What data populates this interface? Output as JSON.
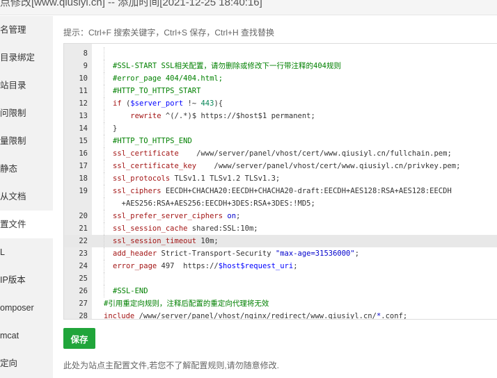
{
  "title": "点修改[www.qiusiyl.cn] -- 添加时间[2021-12-25 18:40:16]",
  "sidebar": {
    "items": [
      {
        "label": "名管理",
        "active": false
      },
      {
        "label": "目录绑定",
        "active": false
      },
      {
        "label": "站目录",
        "active": false
      },
      {
        "label": "问限制",
        "active": false
      },
      {
        "label": "量限制",
        "active": false
      },
      {
        "label": "静态",
        "active": false
      },
      {
        "label": "从文档",
        "active": false
      },
      {
        "label": "置文件",
        "active": true
      },
      {
        "label": "L",
        "active": false
      },
      {
        "label": "IP版本",
        "active": false
      },
      {
        "label": "omposer",
        "active": false
      },
      {
        "label": "mcat",
        "active": false
      },
      {
        "label": "定向",
        "active": false
      }
    ]
  },
  "hint": "提示：Ctrl+F 搜索关键字，Ctrl+S 保存，Ctrl+H 查找替换",
  "editor": {
    "active_line": "22",
    "lines": [
      {
        "n": "8",
        "parts": []
      },
      {
        "n": "9",
        "parts": [
          [
            "cm",
            "#SSL-START SSL相关配置，请勿删除或修改下一行带注释的404规则"
          ]
        ]
      },
      {
        "n": "10",
        "parts": [
          [
            "cm",
            "#error_page 404/404.html;"
          ]
        ]
      },
      {
        "n": "11",
        "parts": [
          [
            "cm",
            "#HTTP_TO_HTTPS_START"
          ]
        ]
      },
      {
        "n": "12",
        "parts": [
          [
            "kw",
            "if"
          ],
          [
            "op",
            " ("
          ],
          [
            "var",
            "$server_port"
          ],
          [
            "op",
            " !~ "
          ],
          [
            "num",
            "443"
          ],
          [
            "op",
            "){"
          ]
        ]
      },
      {
        "n": "13",
        "parts": [
          [
            "op",
            "    "
          ],
          [
            "kw",
            "rewrite"
          ],
          [
            "op",
            " ^(/.*)$ https://$host$1 permanent;"
          ]
        ]
      },
      {
        "n": "14",
        "parts": [
          [
            "op",
            "}"
          ]
        ]
      },
      {
        "n": "15",
        "parts": [
          [
            "cm",
            "#HTTP_TO_HTTPS_END"
          ]
        ]
      },
      {
        "n": "16",
        "parts": [
          [
            "kw",
            "ssl_certificate"
          ],
          [
            "op",
            "    /www/server/panel/vhost/cert/www.qiusiyl.cn/fullchain.pem;"
          ]
        ]
      },
      {
        "n": "17",
        "parts": [
          [
            "kw",
            "ssl_certificate_key"
          ],
          [
            "op",
            "    /www/server/panel/vhost/cert/www.qiusiyl.cn/privkey.pem;"
          ]
        ]
      },
      {
        "n": "18",
        "parts": [
          [
            "kw",
            "ssl_protocols"
          ],
          [
            "op",
            " TLSv1.1 TLSv1.2 TLSv1.3;"
          ]
        ]
      },
      {
        "n": "19",
        "parts": [
          [
            "kw",
            "ssl_ciphers"
          ],
          [
            "op",
            " EECDH+CHACHA20:EECDH+CHACHA20-draft:EECDH+AES128:RSA+AES128:EECDH"
          ]
        ]
      },
      {
        "n": "",
        "parts": [
          [
            "op",
            "  +AES256:RSA+AES256:EECDH+3DES:RSA+3DES:!MD5;"
          ]
        ]
      },
      {
        "n": "20",
        "parts": [
          [
            "kw",
            "ssl_prefer_server_ciphers"
          ],
          [
            "op",
            " "
          ],
          [
            "str",
            "on"
          ],
          [
            "op",
            ";"
          ]
        ]
      },
      {
        "n": "21",
        "parts": [
          [
            "kw",
            "ssl_session_cache"
          ],
          [
            "op",
            " shared:SSL:10m;"
          ]
        ]
      },
      {
        "n": "22",
        "parts": [
          [
            "kw",
            "ssl_session_timeout"
          ],
          [
            "op",
            " 10m;"
          ]
        ]
      },
      {
        "n": "23",
        "parts": [
          [
            "kw",
            "add_header"
          ],
          [
            "op",
            " Strict-Transport-Security "
          ],
          [
            "str",
            "\"max-age=31536000\""
          ],
          [
            "op",
            ";"
          ]
        ]
      },
      {
        "n": "24",
        "parts": [
          [
            "kw",
            "error_page"
          ],
          [
            "op",
            " 497  https://"
          ],
          [
            "var",
            "$host$request_uri"
          ],
          [
            "op",
            ";"
          ]
        ]
      },
      {
        "n": "25",
        "parts": []
      },
      {
        "n": "26",
        "parts": [
          [
            "cm",
            "#SSL-END"
          ]
        ]
      },
      {
        "n": "27",
        "parts": [
          [
            "cm",
            "#引用重定向规则，注释后配置的重定向代理将无效"
          ]
        ],
        "root": true
      },
      {
        "n": "28",
        "parts": [
          [
            "kw",
            "include"
          ],
          [
            "op",
            " /www/server/panel/vhost/nginx/redirect/www.qiusiyl.cn/"
          ],
          [
            "str",
            "*"
          ],
          [
            "op",
            ".conf;"
          ]
        ],
        "root": true
      }
    ]
  },
  "save_label": "保存",
  "footer_note": "此处为站点主配置文件,若您不了解配置规则,请勿随意修改."
}
